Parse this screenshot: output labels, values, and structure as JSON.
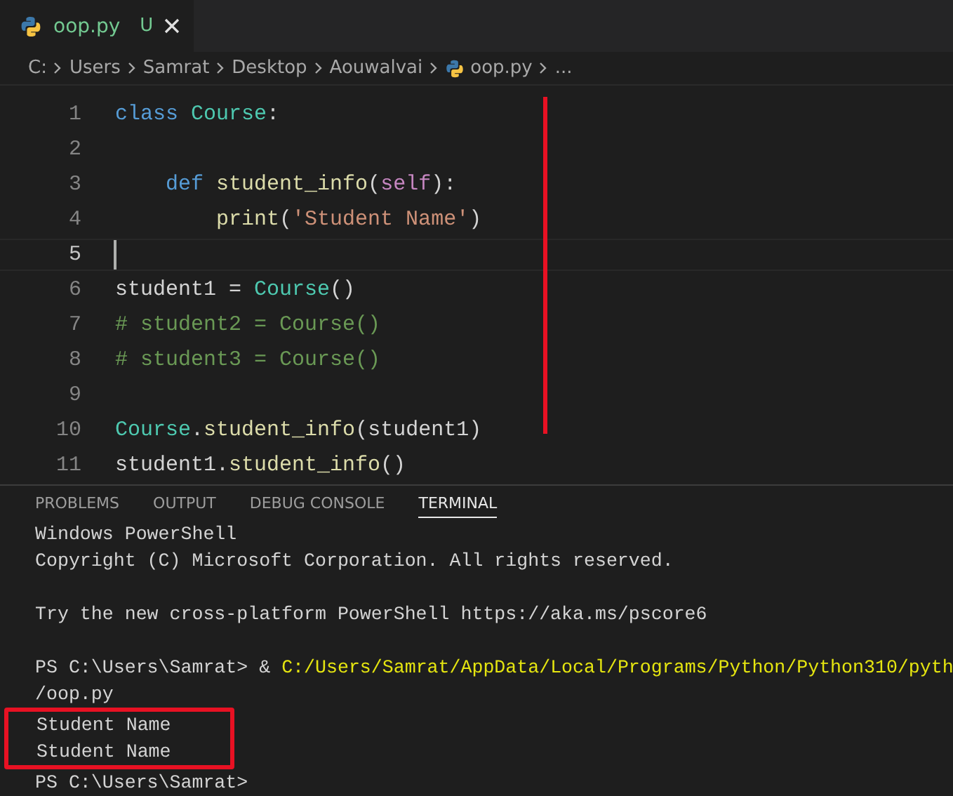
{
  "tabs": [
    {
      "label": "oop.py",
      "status": "U",
      "selected": true
    }
  ],
  "breadcrumb": [
    {
      "label": "C:",
      "kind": "folder"
    },
    {
      "label": "Users",
      "kind": "folder"
    },
    {
      "label": "Samrat",
      "kind": "folder"
    },
    {
      "label": "Desktop",
      "kind": "folder"
    },
    {
      "label": "Aouwalvai",
      "kind": "folder"
    },
    {
      "label": "oop.py",
      "kind": "file"
    },
    {
      "label": "...",
      "kind": "more"
    }
  ],
  "code_lines": [
    {
      "number": "1",
      "current": false,
      "tokens": [
        {
          "text": "class ",
          "kind": "keyword"
        },
        {
          "text": "Course",
          "kind": "class"
        },
        {
          "text": ":",
          "kind": "plain"
        }
      ]
    },
    {
      "number": "2",
      "current": false
    },
    {
      "number": "3",
      "current": false,
      "tokens": [
        {
          "text": "    def ",
          "kind": "keyword"
        },
        {
          "text": "student_info",
          "kind": "function"
        },
        {
          "text": "(",
          "kind": "plain"
        },
        {
          "text": "self",
          "kind": "param"
        },
        {
          "text": "):",
          "kind": "plain"
        }
      ]
    },
    {
      "number": "4",
      "current": false,
      "tokens": [
        {
          "text": "        print",
          "kind": "function"
        },
        {
          "text": "(",
          "kind": "plain"
        },
        {
          "text": "'Student Name'",
          "kind": "string"
        },
        {
          "text": ")",
          "kind": "plain"
        }
      ]
    },
    {
      "number": "5",
      "current": true
    },
    {
      "number": "6",
      "current": false,
      "tokens": [
        {
          "text": "student1 = ",
          "kind": "plain"
        },
        {
          "text": "Course",
          "kind": "class"
        },
        {
          "text": "()",
          "kind": "plain"
        }
      ]
    },
    {
      "number": "7",
      "current": false,
      "tokens": [
        {
          "text": "# student2 = Course()",
          "kind": "comment"
        }
      ]
    },
    {
      "number": "8",
      "current": false,
      "tokens": [
        {
          "text": "# student3 = Course()",
          "kind": "comment"
        }
      ]
    },
    {
      "number": "9",
      "current": false
    },
    {
      "number": "10",
      "current": false,
      "tokens": [
        {
          "text": "Course",
          "kind": "class"
        },
        {
          "text": ".",
          "kind": "plain"
        },
        {
          "text": "student_info",
          "kind": "function"
        },
        {
          "text": "(student1)",
          "kind": "plain"
        }
      ]
    },
    {
      "number": "11",
      "current": false,
      "tokens": [
        {
          "text": "student1.",
          "kind": "plain"
        },
        {
          "text": "student_info",
          "kind": "function"
        },
        {
          "text": "()",
          "kind": "plain"
        }
      ]
    }
  ],
  "panel_tabs": [
    {
      "label": "PROBLEMS",
      "selected": false
    },
    {
      "label": "OUTPUT",
      "selected": false
    },
    {
      "label": "DEBUG CONSOLE",
      "selected": false
    },
    {
      "label": "TERMINAL",
      "selected": true
    }
  ],
  "terminal_lines": [
    {
      "highlighted": false,
      "segments": [
        {
          "text": "Windows PowerShell",
          "kind": "plain"
        }
      ]
    },
    {
      "highlighted": false,
      "segments": [
        {
          "text": "Copyright (C) Microsoft Corporation. All rights reserved.",
          "kind": "plain"
        }
      ]
    },
    {
      "highlighted": false
    },
    {
      "highlighted": false,
      "segments": [
        {
          "text": "Try the new cross-platform PowerShell https://aka.ms/pscore6",
          "kind": "plain"
        }
      ]
    },
    {
      "highlighted": false
    },
    {
      "highlighted": false,
      "segments": [
        {
          "text": "PS C:\\Users\\Samrat> & ",
          "kind": "plain"
        },
        {
          "text": "C:/Users/Samrat/AppData/Local/Programs/Python/Python310/pyth",
          "kind": "path"
        }
      ]
    },
    {
      "highlighted": false,
      "segments": [
        {
          "text": "/oop.py",
          "kind": "plain"
        }
      ]
    },
    {
      "highlighted": true,
      "segments": [
        {
          "text": "Student Name",
          "kind": "plain"
        }
      ]
    },
    {
      "highlighted": true,
      "segments": [
        {
          "text": "Student Name",
          "kind": "plain"
        }
      ]
    },
    {
      "highlighted": false,
      "segments": [
        {
          "text": "PS C:\\Users\\Samrat>",
          "kind": "plain"
        }
      ]
    }
  ]
}
